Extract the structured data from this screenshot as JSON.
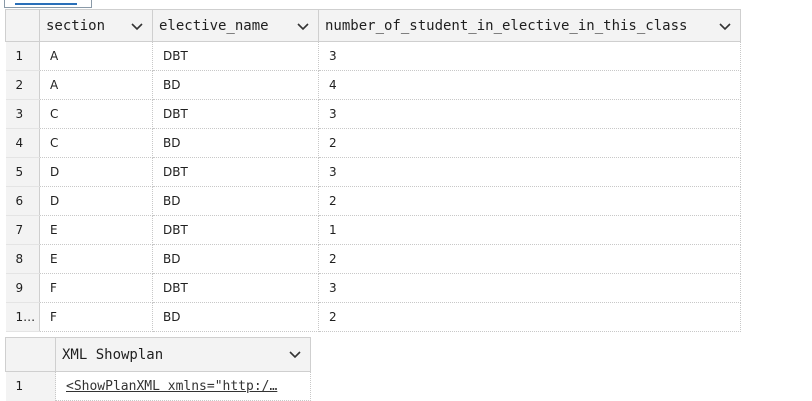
{
  "results": {
    "columns": [
      "section",
      "elective_name",
      "number_of_student_in_elective_in_this_class"
    ],
    "rows": [
      {
        "n": "1",
        "section": "A",
        "elective": "DBT",
        "count": "3"
      },
      {
        "n": "2",
        "section": "A",
        "elective": "BD",
        "count": "4"
      },
      {
        "n": "3",
        "section": "C",
        "elective": "DBT",
        "count": "3"
      },
      {
        "n": "4",
        "section": "C",
        "elective": "BD",
        "count": "2"
      },
      {
        "n": "5",
        "section": "D",
        "elective": "DBT",
        "count": "3"
      },
      {
        "n": "6",
        "section": "D",
        "elective": "BD",
        "count": "2"
      },
      {
        "n": "7",
        "section": "E",
        "elective": "DBT",
        "count": "1"
      },
      {
        "n": "8",
        "section": "E",
        "elective": "BD",
        "count": "2"
      },
      {
        "n": "9",
        "section": "F",
        "elective": "DBT",
        "count": "3"
      },
      {
        "n": "1…",
        "section": "F",
        "elective": "BD",
        "count": "2"
      }
    ]
  },
  "showplan": {
    "column": "XML Showplan",
    "rows": [
      {
        "n": "1",
        "value": "<ShowPlanXML xmlns=\"http:/…"
      }
    ]
  },
  "icons": {
    "sort": "chevron-down-icon"
  }
}
